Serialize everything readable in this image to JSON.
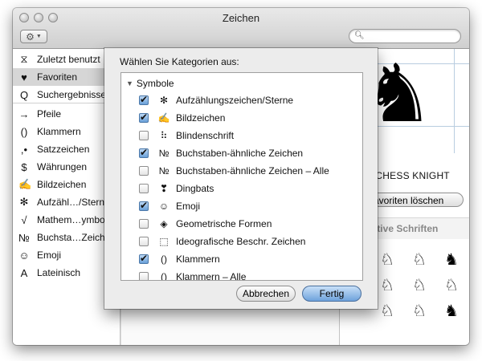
{
  "window": {
    "title": "Zeichen"
  },
  "toolbar": {
    "gear_icon": "gear-icon",
    "search_placeholder": "",
    "search_value": ""
  },
  "sidebar": {
    "items": [
      {
        "icon": "⧖",
        "icon_name": "clock-icon",
        "label": "Zuletzt benutzt"
      },
      {
        "icon": "♥",
        "icon_name": "heart-icon",
        "label": "Favoriten",
        "selected": true
      },
      {
        "icon": "Q",
        "icon_name": "search-results-icon",
        "label": "Suchergebnisse"
      },
      {
        "icon": "→",
        "icon_name": "arrow-icon",
        "label": "Pfeile"
      },
      {
        "icon": "()",
        "icon_name": "parentheses-icon",
        "label": "Klammern"
      },
      {
        "icon": ",•",
        "icon_name": "punctuation-icon",
        "label": "Satzzeichen"
      },
      {
        "icon": "$",
        "icon_name": "dollar-icon",
        "label": "Währungen"
      },
      {
        "icon": "✍",
        "icon_name": "pictograph-icon",
        "label": "Bildzeichen"
      },
      {
        "icon": "✻",
        "icon_name": "asterisk-icon",
        "label": "Aufzähl…/Stern"
      },
      {
        "icon": "√",
        "icon_name": "math-icon",
        "label": "Mathem…ymbo"
      },
      {
        "icon": "№",
        "icon_name": "numero-icon",
        "label": "Buchsta…Zeiche"
      },
      {
        "icon": "☺",
        "icon_name": "smiley-icon",
        "label": "Emoji"
      },
      {
        "icon": "A",
        "icon_name": "latin-letter-icon",
        "label": "Lateinisch"
      }
    ]
  },
  "preview": {
    "glyph": "♞",
    "char_name": "TE CHESS KNIGHT",
    "remove_favorite_label": "Favoriten löschen",
    "alt_fonts_header": "ative Schriften",
    "alt_glyphs": [
      "♘",
      "♘",
      "♞",
      "♘",
      "♘",
      "♘",
      "♘",
      "♘",
      "♞"
    ]
  },
  "sheet": {
    "prompt": "Wählen Sie Kategorien aus:",
    "group_label": "Symbole",
    "rows": [
      {
        "checked": true,
        "symbol": "✻",
        "icon_name": "asterisk-icon",
        "label": "Aufzählungszeichen/Sterne"
      },
      {
        "checked": true,
        "symbol": "✍",
        "icon_name": "pictograph-icon",
        "label": "Bildzeichen"
      },
      {
        "checked": false,
        "symbol": "⠷",
        "icon_name": "braille-icon",
        "label": "Blindenschrift"
      },
      {
        "checked": true,
        "symbol": "№",
        "icon_name": "numero-icon",
        "label": "Buchstaben-ähnliche Zeichen"
      },
      {
        "checked": false,
        "symbol": "№",
        "icon_name": "numero-icon",
        "label": "Buchstaben-ähnliche Zeichen – Alle"
      },
      {
        "checked": false,
        "symbol": "❣",
        "icon_name": "dingbat-icon",
        "label": "Dingbats"
      },
      {
        "checked": true,
        "symbol": "☺",
        "icon_name": "smiley-icon",
        "label": "Emoji"
      },
      {
        "checked": false,
        "symbol": "◈",
        "icon_name": "diamond-icon",
        "label": "Geometrische Formen"
      },
      {
        "checked": false,
        "symbol": "⬚",
        "icon_name": "dashed-square-icon",
        "label": "Ideografische Beschr. Zeichen"
      },
      {
        "checked": true,
        "symbol": "()",
        "icon_name": "parentheses-icon",
        "label": "Klammern"
      },
      {
        "checked": false,
        "symbol": "()",
        "icon_name": "parentheses-icon",
        "label": "Klammern – Alle"
      }
    ],
    "cancel_label": "Abbrechen",
    "done_label": "Fertig"
  }
}
